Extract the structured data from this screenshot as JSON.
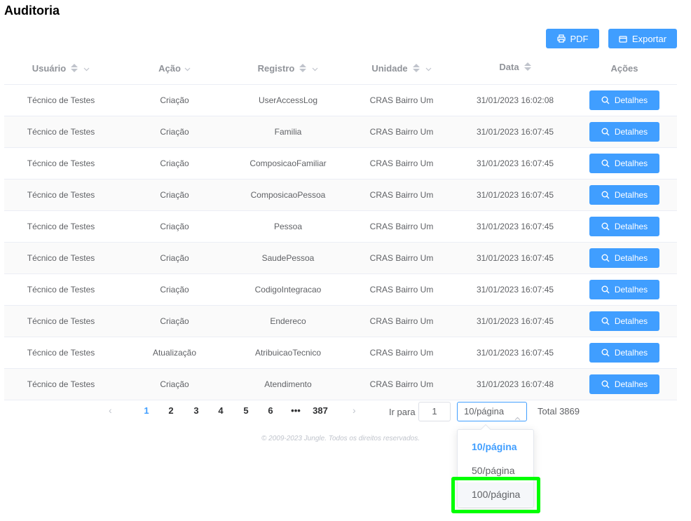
{
  "page": {
    "title": "Auditoria"
  },
  "toolbar": {
    "pdf_label": "PDF",
    "export_label": "Exportar"
  },
  "table": {
    "headers": {
      "usuario": "Usuário",
      "acao": "Ação",
      "registro": "Registro",
      "unidade": "Unidade",
      "data": "Data",
      "acoes": "Ações"
    },
    "action_label": "Detalhes",
    "rows": [
      {
        "usuario": "Técnico de Testes",
        "acao": "Criação",
        "registro": "UserAccessLog",
        "unidade": "CRAS Bairro Um",
        "data": "31/01/2023 16:02:08"
      },
      {
        "usuario": "Técnico de Testes",
        "acao": "Criação",
        "registro": "Familia",
        "unidade": "CRAS Bairro Um",
        "data": "31/01/2023 16:07:45"
      },
      {
        "usuario": "Técnico de Testes",
        "acao": "Criação",
        "registro": "ComposicaoFamiliar",
        "unidade": "CRAS Bairro Um",
        "data": "31/01/2023 16:07:45"
      },
      {
        "usuario": "Técnico de Testes",
        "acao": "Criação",
        "registro": "ComposicaoPessoa",
        "unidade": "CRAS Bairro Um",
        "data": "31/01/2023 16:07:45"
      },
      {
        "usuario": "Técnico de Testes",
        "acao": "Criação",
        "registro": "Pessoa",
        "unidade": "CRAS Bairro Um",
        "data": "31/01/2023 16:07:45"
      },
      {
        "usuario": "Técnico de Testes",
        "acao": "Criação",
        "registro": "SaudePessoa",
        "unidade": "CRAS Bairro Um",
        "data": "31/01/2023 16:07:45"
      },
      {
        "usuario": "Técnico de Testes",
        "acao": "Criação",
        "registro": "CodigoIntegracao",
        "unidade": "CRAS Bairro Um",
        "data": "31/01/2023 16:07:45"
      },
      {
        "usuario": "Técnico de Testes",
        "acao": "Criação",
        "registro": "Endereco",
        "unidade": "CRAS Bairro Um",
        "data": "31/01/2023 16:07:45"
      },
      {
        "usuario": "Técnico de Testes",
        "acao": "Atualização",
        "registro": "AtribuicaoTecnico",
        "unidade": "CRAS Bairro Um",
        "data": "31/01/2023 16:07:45"
      },
      {
        "usuario": "Técnico de Testes",
        "acao": "Criação",
        "registro": "Atendimento",
        "unidade": "CRAS Bairro Um",
        "data": "31/01/2023 16:07:48"
      }
    ]
  },
  "pagination": {
    "pages": [
      "1",
      "2",
      "3",
      "4",
      "5",
      "6",
      "•••",
      "387"
    ],
    "current_page": "1",
    "goto_label": "Ir para",
    "goto_value": "1",
    "page_size": "10/página",
    "total": "Total 3869",
    "size_options": [
      "10/página",
      "50/página",
      "100/página"
    ]
  },
  "footer": {
    "text": "© 2009-2023 Jungle. Todos os direitos reservados."
  },
  "colors": {
    "primary": "#409eff",
    "highlight": "#00ff00"
  },
  "icons": {
    "pdf": "printer-icon",
    "export": "export-icon",
    "details": "search-icon"
  }
}
